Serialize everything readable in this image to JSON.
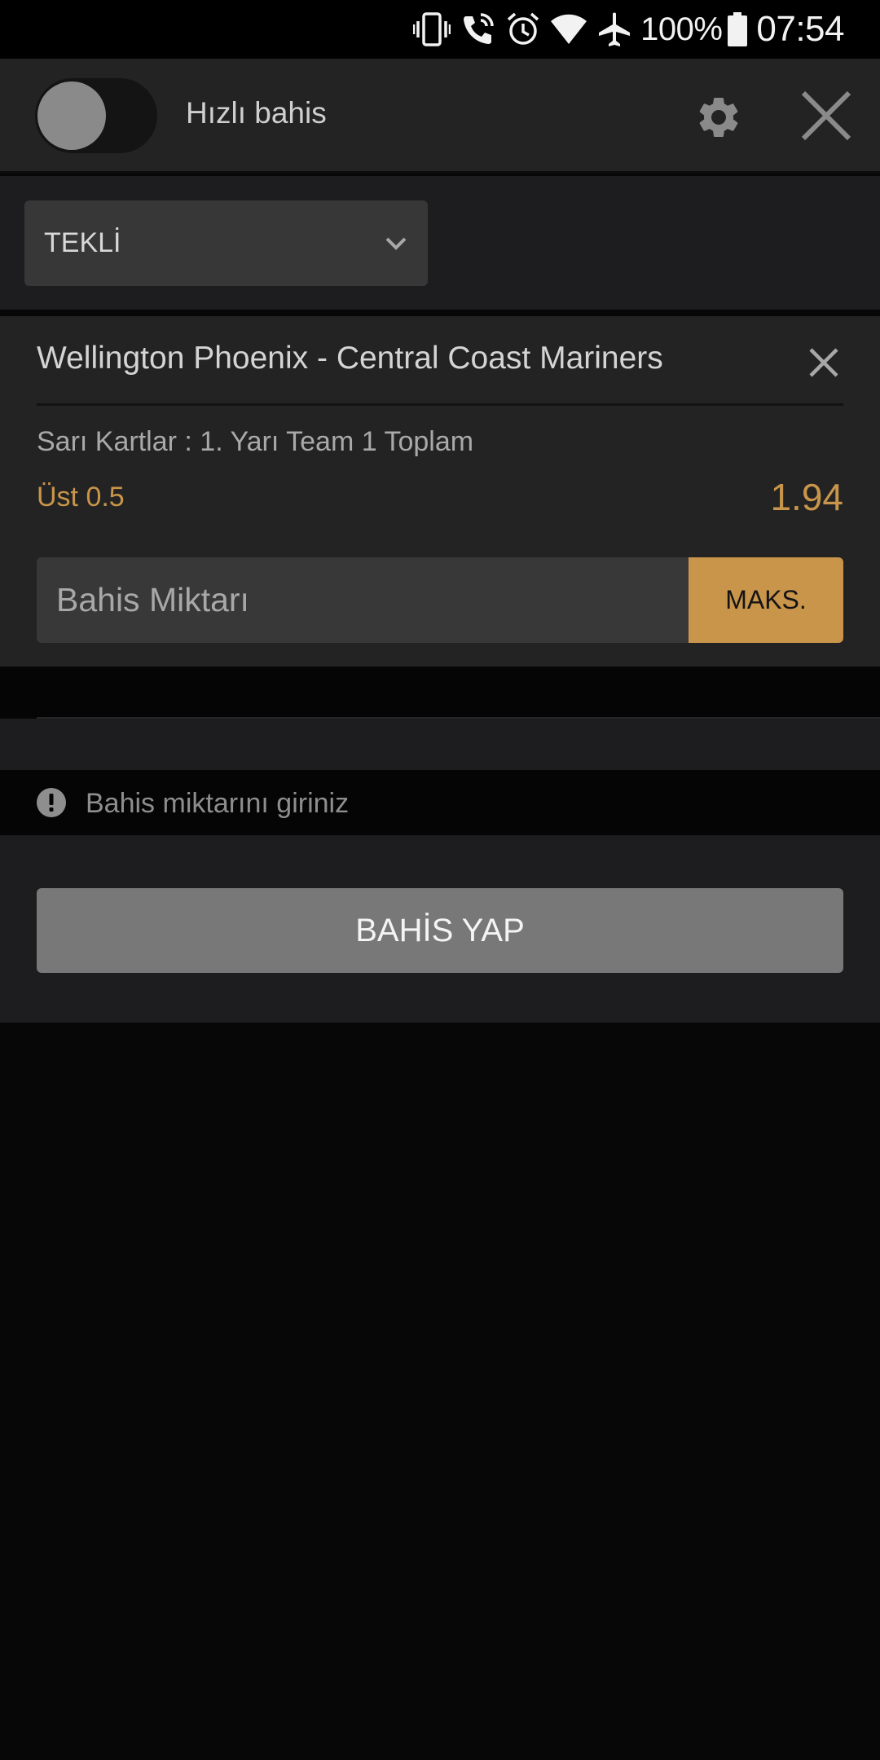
{
  "status_bar": {
    "battery_percent": "100%",
    "time": "07:54",
    "icons": [
      "vibrate-icon",
      "wifi-call-icon",
      "alarm-icon",
      "wifi-icon",
      "airplane-icon",
      "battery-icon"
    ]
  },
  "header": {
    "quick_bet_label": "Hızlı bahis",
    "quick_bet_enabled": false,
    "icons": [
      "gear-icon",
      "close-icon"
    ]
  },
  "bet_type": {
    "selected": "TEKLİ"
  },
  "bet": {
    "match": "Wellington Phoenix - Central Coast Mariners",
    "market": "Sarı Kartlar : 1. Yarı Team 1 Toplam",
    "selection": "Üst 0.5",
    "odds": "1.94",
    "stake_placeholder": "Bahis Miktarı",
    "max_label": "MAKS."
  },
  "warning": {
    "text": "Bahis miktarını giriniz"
  },
  "place_bet": {
    "label": "BAHİS YAP"
  },
  "colors": {
    "accent": "#c9954a",
    "background": "#070707",
    "panel": "#232323",
    "button_disabled": "#787878"
  }
}
